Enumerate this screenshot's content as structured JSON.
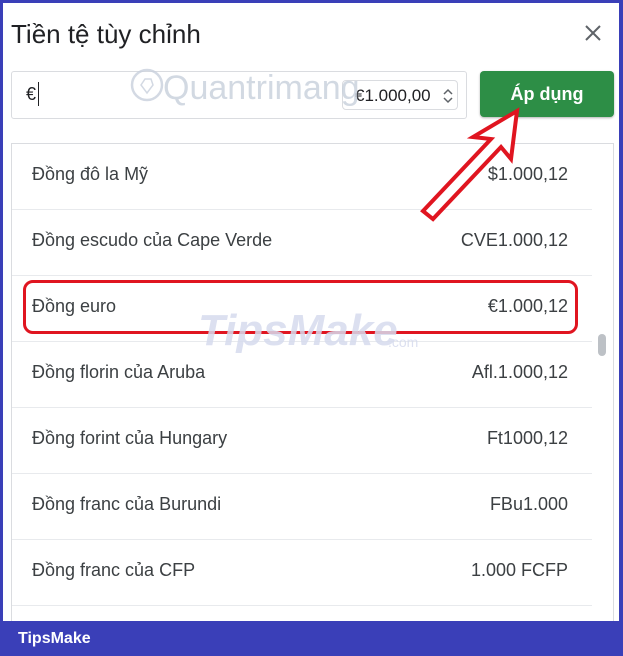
{
  "dialog": {
    "title": "Tiền tệ tùy chỉnh",
    "close_icon": "close-icon"
  },
  "currency_input": {
    "value": "€"
  },
  "format_select": {
    "selected": "€1.000,00",
    "icon": "sort-icon"
  },
  "apply_button": {
    "label": "Áp dụng",
    "color": "#2d8e46"
  },
  "currency_list": [
    {
      "name": "Đồng đô la Mỹ",
      "sample": "$1.000,12"
    },
    {
      "name": "Đồng escudo của Cape Verde",
      "sample": "CVE1.000,12"
    },
    {
      "name": "Đồng euro",
      "sample": "€1.000,12",
      "highlighted": true
    },
    {
      "name": "Đồng florin của Aruba",
      "sample": "Afl.1.000,12"
    },
    {
      "name": "Đồng forint của Hungary",
      "sample": "Ft1000,12"
    },
    {
      "name": "Đồng franc của Burundi",
      "sample": "FBu1.000"
    },
    {
      "name": "Đồng franc của CFP",
      "sample": "1.000 FCFP"
    }
  ],
  "annotation": {
    "highlight_color": "#e01520",
    "arrow_color": "#e01520"
  },
  "watermarks": {
    "top": "Quantrimang",
    "middle": "TipsMake",
    "middle_suffix": ".com"
  },
  "footer": {
    "brand": "TipsMake",
    "color": "#3a3fb8"
  }
}
